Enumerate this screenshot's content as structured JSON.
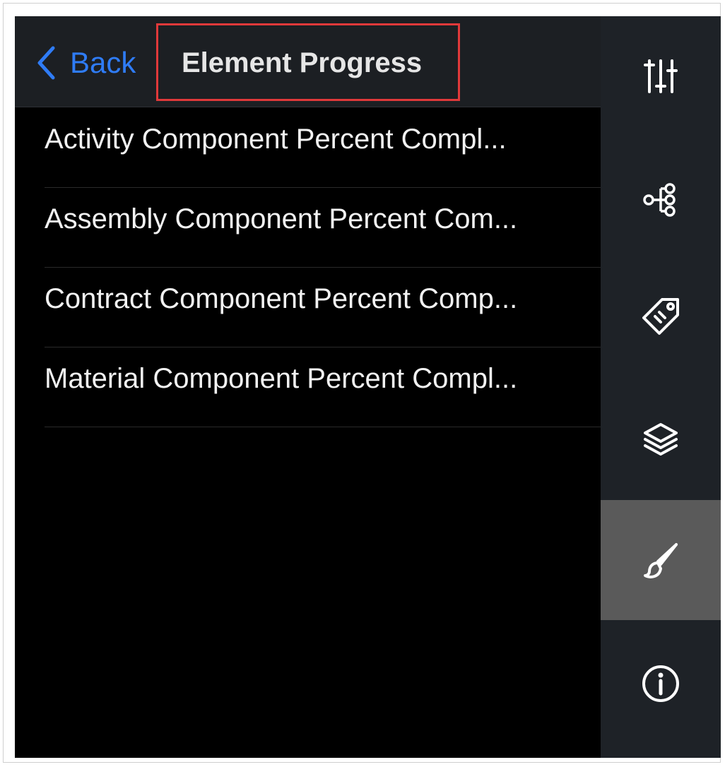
{
  "header": {
    "back_label": "Back",
    "title": "Element Progress"
  },
  "list": {
    "items": [
      {
        "label": "Activity Component Percent Compl..."
      },
      {
        "label": "Assembly Component Percent Com..."
      },
      {
        "label": "Contract Component Percent Comp..."
      },
      {
        "label": "Material Component Percent Compl..."
      }
    ]
  },
  "toolbar": {
    "tools": [
      {
        "icon": "sliders-icon"
      },
      {
        "icon": "hierarchy-icon"
      },
      {
        "icon": "tag-icon"
      },
      {
        "icon": "layers-icon"
      },
      {
        "icon": "paintbrush-icon",
        "active": true
      },
      {
        "icon": "info-icon"
      }
    ]
  },
  "colors": {
    "accent": "#2f7cf6",
    "highlight_box": "#e0393a",
    "header_bg": "#1c1f23",
    "toolbar_bg": "#1e2227",
    "active_tool_bg": "#5a5a5a",
    "list_bg": "#000000",
    "text": "#f2f2f2"
  }
}
